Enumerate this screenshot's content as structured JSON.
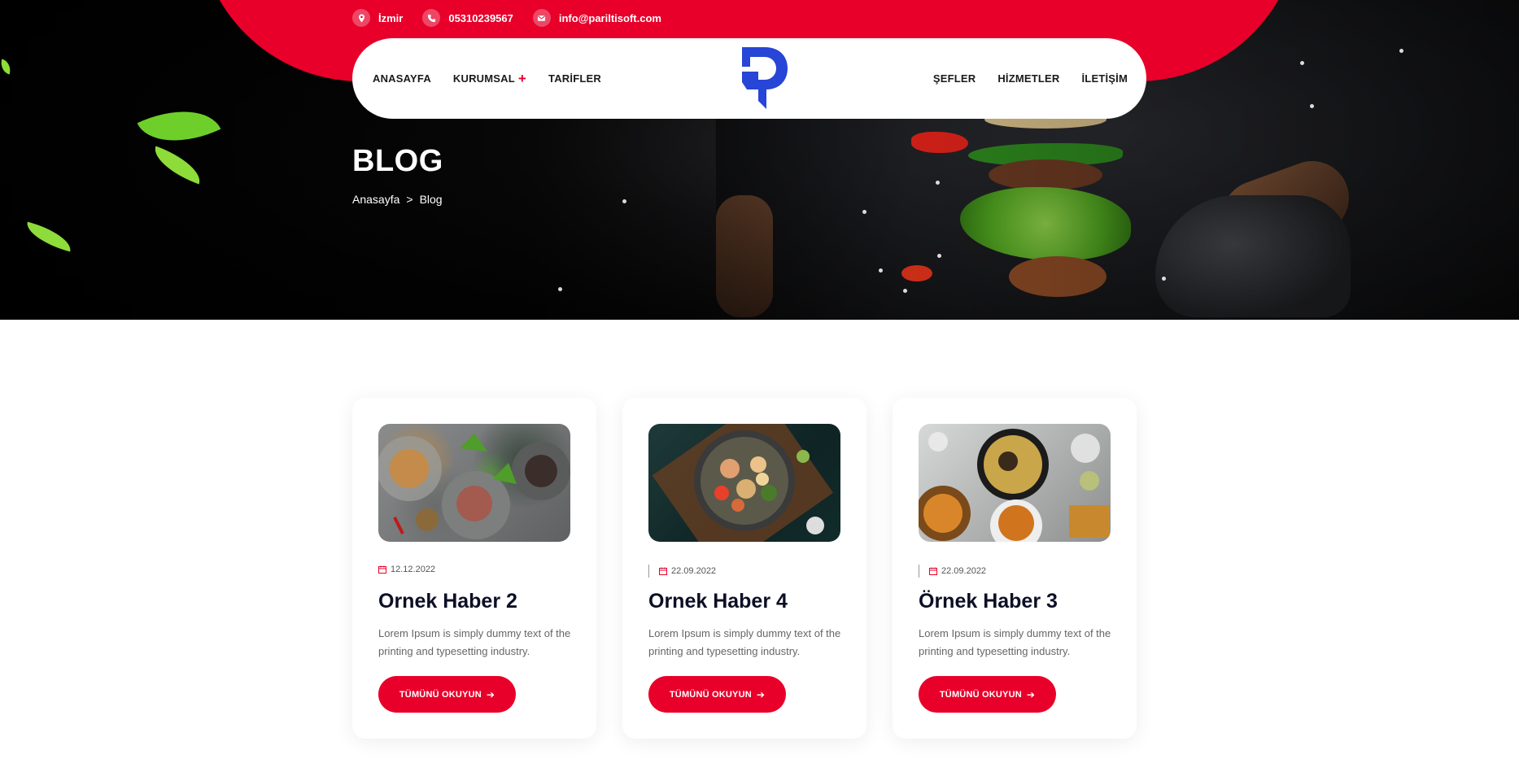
{
  "topbar": {
    "location": "İzmir",
    "phone": "05310239567",
    "email": "info@pariltisoft.com"
  },
  "nav": {
    "left": [
      "ANASAYFA",
      "KURUMSAL",
      "TARİFLER"
    ],
    "kurumsal_plus": "+",
    "right": [
      "ŞEFLER",
      "HİZMETLER",
      "İLETİŞİM"
    ]
  },
  "hero": {
    "title": "BLOG",
    "breadcrumb": [
      "Anasayfa",
      "Blog"
    ],
    "breadcrumb_sep": ">"
  },
  "colors": {
    "accent": "#e8002a",
    "logo": "#2745d6",
    "title": "#0c0f24"
  },
  "cards": [
    {
      "date": "12.12.2022",
      "title": "Ornek Haber 2",
      "text": "Lorem Ipsum is simply dummy text of the printing and typesetting industry.",
      "button": "TÜMÜNÜ OKUYUN"
    },
    {
      "date": "22.09.2022",
      "title": "Ornek Haber 4",
      "text": "Lorem Ipsum is simply dummy text of the printing and typesetting industry.",
      "button": "TÜMÜNÜ OKUYUN"
    },
    {
      "date": "22.09.2022",
      "title": "Örnek Haber 3",
      "text": "Lorem Ipsum is simply dummy text of the printing and typesetting industry.",
      "button": "TÜMÜNÜ OKUYUN"
    }
  ]
}
